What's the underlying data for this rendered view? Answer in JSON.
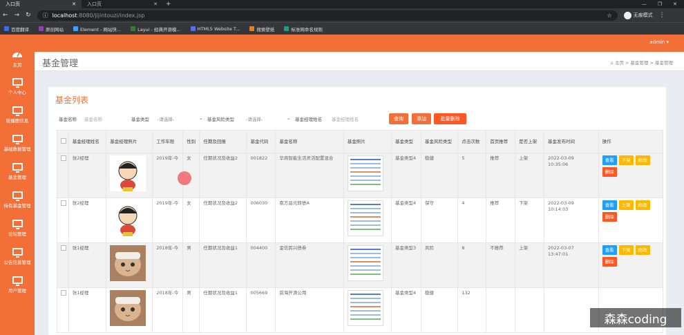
{
  "browser": {
    "tabs": [
      {
        "title": "入口页"
      },
      {
        "title": "入口页"
      }
    ],
    "url_host": "localhost",
    "url_path": ":8080/jijintouzi/index.jsp",
    "profile_label": "无痕模式",
    "bookmarks": [
      {
        "label": "百度翻译",
        "color": "#3b6fe0"
      },
      {
        "label": "原创网站",
        "color": "#8e44ad"
      },
      {
        "label": "Element - 网站快...",
        "color": "#409eff"
      },
      {
        "label": "Layui - 经典开源模...",
        "color": "#2e7d32"
      },
      {
        "label": "HTML5 Website T...",
        "color": "#5b6ee1"
      },
      {
        "label": "搜索壁纸",
        "color": "#e67e22"
      },
      {
        "label": "标准网命名规则",
        "color": "#16a085"
      }
    ]
  },
  "topbar": {
    "user": "admin"
  },
  "sidebar": {
    "items": [
      {
        "label": "主页",
        "icon": "dashboard-icon"
      },
      {
        "label": "个人中心",
        "icon": "monitor-icon"
      },
      {
        "label": "轮播图信息",
        "icon": "monitor-icon"
      },
      {
        "label": "基础数据管理",
        "icon": "monitor-icon"
      },
      {
        "label": "基金管理",
        "icon": "monitor-icon"
      },
      {
        "label": "持有基金管理",
        "icon": "monitor-icon"
      },
      {
        "label": "论坛管理",
        "icon": "monitor-icon"
      },
      {
        "label": "公告信息管理",
        "icon": "monitor-icon"
      },
      {
        "label": "用户管理",
        "icon": "monitor-icon"
      }
    ]
  },
  "header": {
    "title": "基金管理",
    "breadcrumb": [
      "主页",
      "基金管理",
      "基金管理"
    ]
  },
  "panel": {
    "title": "基金列表"
  },
  "search": {
    "name_label": "基金名称",
    "name_placeholder": "基金名称",
    "type_label": "基金类型",
    "type_value": "-请选择-",
    "risk_label": "基金风险类型",
    "risk_value": "-请选择-",
    "manager_label": "基金经理姓名",
    "manager_placeholder": "基金经理姓名",
    "search_btn": "查询",
    "add_btn": "添加",
    "batch_delete_btn": "批量删除"
  },
  "table": {
    "headers": [
      "基金经理姓名",
      "基金经理照片",
      "工作年限",
      "性别",
      "任期及回报",
      "基金代码",
      "基金名称",
      "基金照片",
      "基金类型",
      "基金风险类型",
      "点击次数",
      "首页推荐",
      "是否上架",
      "基金发布时间",
      "操作"
    ],
    "rows": [
      {
        "manager": "张2经理",
        "photo": "cartoon",
        "years": "2019年-今",
        "gender": "女",
        "tenure": "任期状况及收益2",
        "code": "001822",
        "name": "华商智能生活灵活配置混合",
        "type": "基金类型4",
        "risk": "稳健",
        "clicks": "5",
        "recommend": "推荐",
        "listed": "上架",
        "time": "2022-03-09 10:35:06",
        "toggle": "下架"
      },
      {
        "manager": "张2经理",
        "photo": "cartoon",
        "years": "2019年-今",
        "gender": "女",
        "tenure": "任期状况及收益2",
        "code": "006030",
        "name": "南方昌元转债A",
        "type": "基金类型4",
        "risk": "保守",
        "clicks": "4",
        "recommend": "推荐",
        "listed": "下架",
        "time": "2022-03-09 10:14:03",
        "toggle": "上架"
      },
      {
        "manager": "张1经理",
        "photo": "cat",
        "years": "2018年-今",
        "gender": "男",
        "tenure": "任期状况及收益1",
        "code": "004400",
        "name": "金信民兴债券",
        "type": "基金类型3",
        "risk": "风险",
        "clicks": "8",
        "recommend": "不推荐",
        "listed": "上架",
        "time": "2022-03-07 13:47:01",
        "toggle": "下架"
      },
      {
        "manager": "张1经理",
        "photo": "cat",
        "years": "2018年-今",
        "gender": "男",
        "tenure": "任期状况及收益1",
        "code": "005669",
        "name": "前海开源公用",
        "type": "基金类型4",
        "risk": "稳健",
        "clicks": "132",
        "recommend": "",
        "listed": "",
        "time": "",
        "toggle": ""
      }
    ],
    "actions": {
      "view": "查看",
      "edit": "修改",
      "delete": "删除"
    }
  },
  "watermark": "森森coding",
  "colors": {
    "accent": "#f27037",
    "view": "#1e9fff",
    "warn": "#ffb800",
    "danger": "#ff5722"
  }
}
